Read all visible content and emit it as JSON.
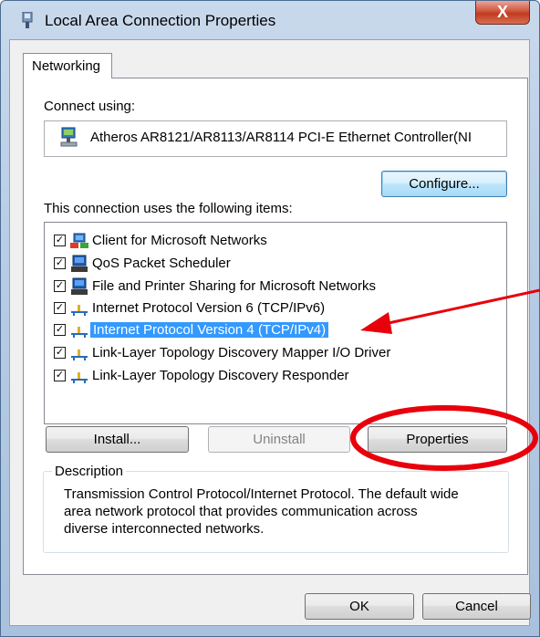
{
  "window": {
    "title": "Local Area Connection Properties",
    "close_label": "X"
  },
  "tabs": [
    {
      "label": "Networking"
    }
  ],
  "connect": {
    "label": "Connect using:",
    "adapter_name": "Atheros AR8121/AR8113/AR8114 PCI-E Ethernet Controller(NI",
    "configure_label": "Configure..."
  },
  "items_section": {
    "label": "This connection uses the following items:",
    "items": [
      {
        "label": "Client for Microsoft Networks",
        "checked": true,
        "icon": "network-client-icon",
        "selected": false
      },
      {
        "label": "QoS Packet Scheduler",
        "checked": true,
        "icon": "service-icon",
        "selected": false
      },
      {
        "label": "File and Printer Sharing for Microsoft Networks",
        "checked": true,
        "icon": "service-icon",
        "selected": false
      },
      {
        "label": "Internet Protocol Version 6 (TCP/IPv6)",
        "checked": true,
        "icon": "protocol-icon",
        "selected": false
      },
      {
        "label": "Internet Protocol Version 4 (TCP/IPv4)",
        "checked": true,
        "icon": "protocol-icon",
        "selected": true
      },
      {
        "label": "Link-Layer Topology Discovery Mapper I/O Driver",
        "checked": true,
        "icon": "protocol-icon",
        "selected": false
      },
      {
        "label": "Link-Layer Topology Discovery Responder",
        "checked": true,
        "icon": "protocol-icon",
        "selected": false
      }
    ]
  },
  "buttons": {
    "install": "Install...",
    "uninstall": "Uninstall",
    "properties": "Properties",
    "ok": "OK",
    "cancel": "Cancel"
  },
  "description": {
    "legend": "Description",
    "line1": "Transmission Control Protocol/Internet Protocol. The default wide",
    "line2": "area network protocol that provides communication across",
    "line3": "diverse interconnected networks."
  },
  "colors": {
    "annotation": "#e8000b",
    "selection": "#3399ff"
  }
}
